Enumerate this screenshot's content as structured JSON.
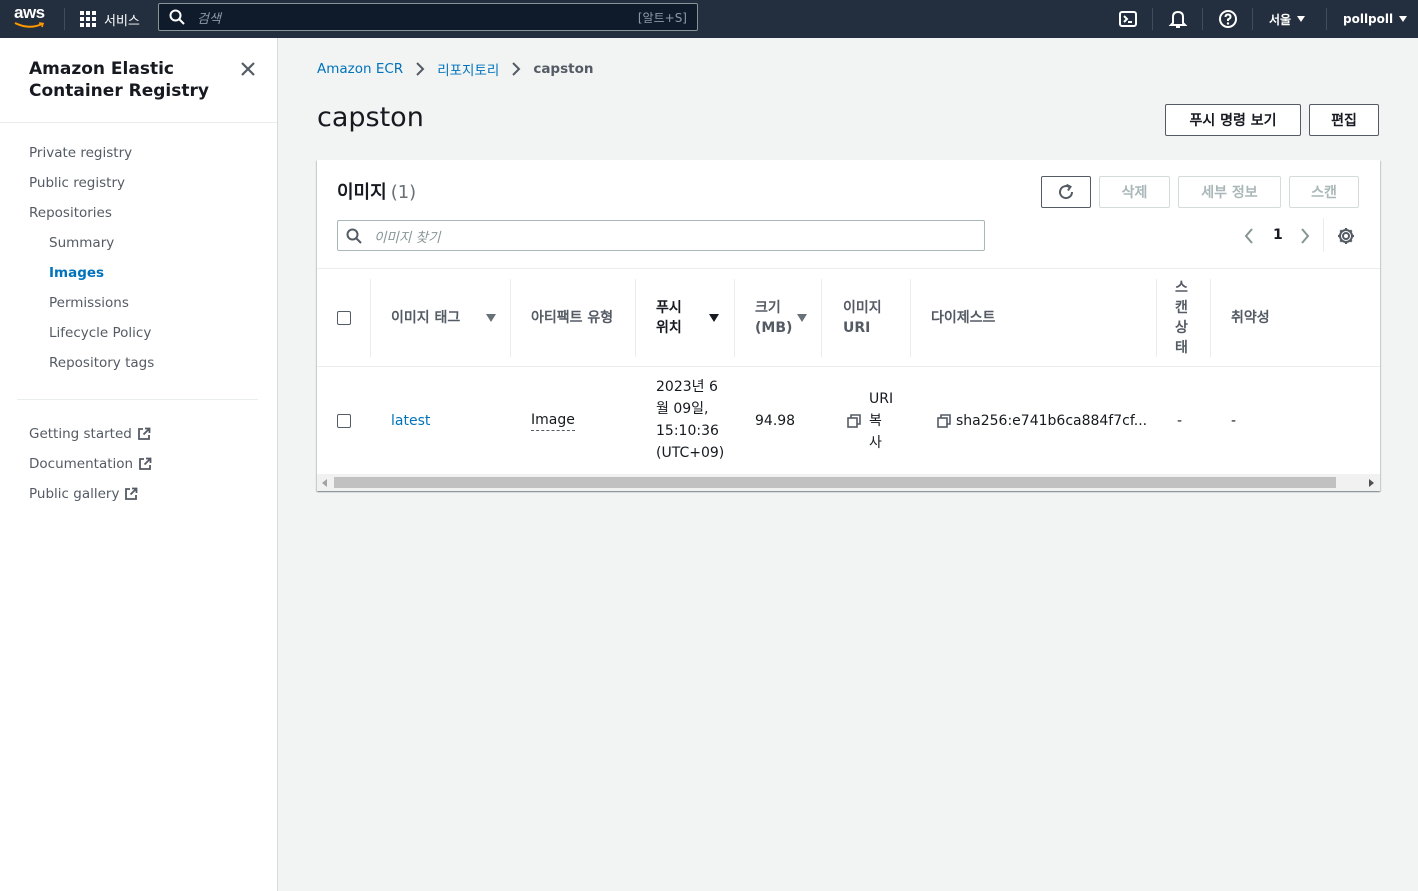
{
  "topnav": {
    "logo": "aws",
    "services_label": "서비스",
    "search_placeholder": "검색",
    "search_shortcut": "[알트+S]",
    "region": "서울",
    "account": "pollpoll",
    "icons": [
      "cloudshell-icon",
      "notifications-bell-icon",
      "help-icon"
    ]
  },
  "sidebar": {
    "title": "Amazon Elastic Container Registry",
    "items": [
      {
        "label": "Private registry"
      },
      {
        "label": "Public registry"
      },
      {
        "label": "Repositories"
      },
      {
        "label": "Summary"
      },
      {
        "label": "Images",
        "active": true
      },
      {
        "label": "Permissions"
      },
      {
        "label": "Lifecycle Policy"
      },
      {
        "label": "Repository tags"
      }
    ],
    "external_links": [
      {
        "label": "Getting started"
      },
      {
        "label": "Documentation"
      },
      {
        "label": "Public gallery"
      }
    ]
  },
  "breadcrumb": [
    "Amazon ECR",
    "리포지토리",
    "capston"
  ],
  "page": {
    "title": "capston",
    "view_push_commands_label": "푸시 명령 보기",
    "edit_label": "편집"
  },
  "images_panel": {
    "title": "이미지",
    "count": "(1)",
    "delete_label": "삭제",
    "details_label": "세부 정보",
    "scan_label": "스캔",
    "filter_placeholder": "이미지 찾기",
    "page": "1",
    "columns": [
      "이미지 태그",
      "아티팩트 유형",
      "푸시 위치",
      "크기 (MB)",
      "이미지 URI",
      "다이제스트",
      "스캔 상태",
      "취약성"
    ],
    "rows": [
      {
        "tag": "latest",
        "artifact_type": "Image",
        "pushed_at": "2023년 6월 09일, 15:10:36 (UTC+09)",
        "size": "94.98",
        "uri": "URI 복사",
        "digest": "sha256:e741b6ca884f7cf...",
        "scan_status": "-",
        "vulnerabilities": "-"
      }
    ]
  },
  "colors": {
    "nav_bg": "#232f3e",
    "link": "#0073bb",
    "page_bg": "#f2f3f3"
  }
}
